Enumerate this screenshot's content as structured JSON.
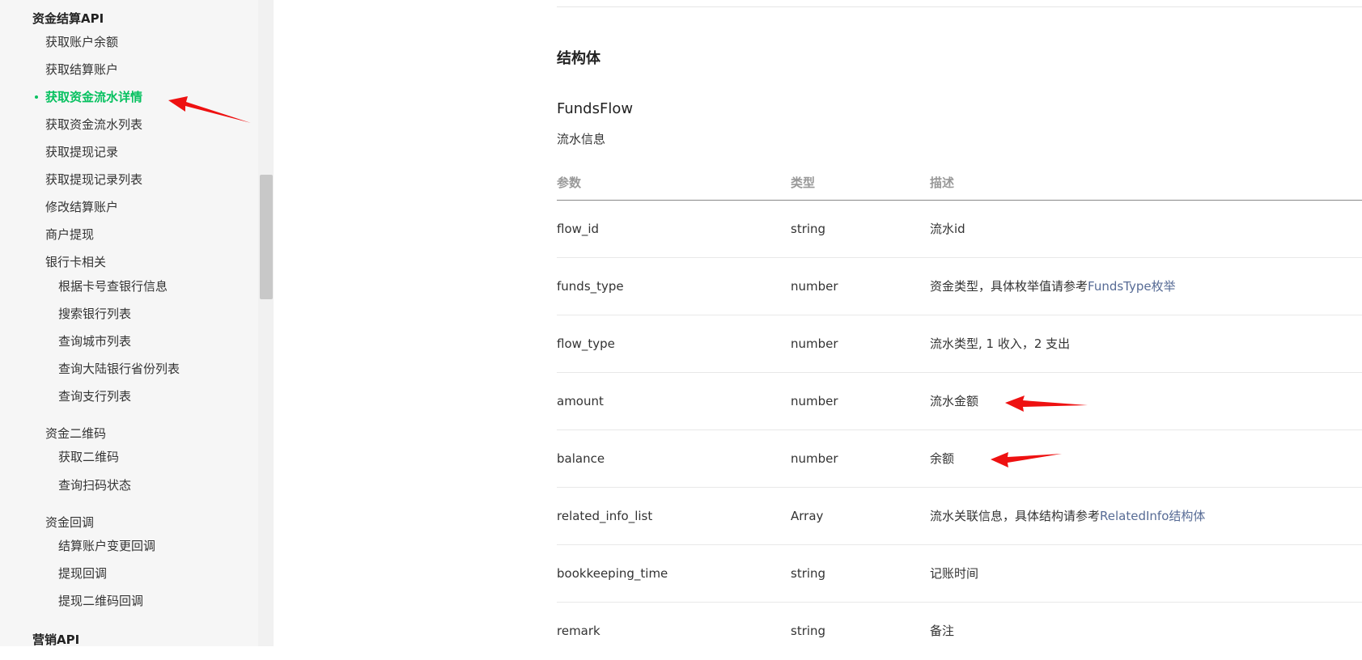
{
  "sidebar": {
    "groups": [
      {
        "label": "资金结算API"
      },
      {
        "label": "营销API"
      }
    ],
    "items": [
      {
        "label": "获取账户余额"
      },
      {
        "label": "获取结算账户"
      },
      {
        "label": "获取资金流水详情",
        "active": true
      },
      {
        "label": "获取资金流水列表"
      },
      {
        "label": "获取提现记录"
      },
      {
        "label": "获取提现记录列表"
      },
      {
        "label": "修改结算账户"
      },
      {
        "label": "商户提现"
      },
      {
        "label": "银行卡相关"
      },
      {
        "label": "根据卡号查银行信息"
      },
      {
        "label": "搜索银行列表"
      },
      {
        "label": "查询城市列表"
      },
      {
        "label": "查询大陆银行省份列表"
      },
      {
        "label": "查询支行列表"
      },
      {
        "label": "资金二维码"
      },
      {
        "label": "获取二维码"
      },
      {
        "label": "查询扫码状态"
      },
      {
        "label": "资金回调"
      },
      {
        "label": "结算账户变更回调"
      },
      {
        "label": "提现回调"
      },
      {
        "label": "提现二维码回调"
      }
    ]
  },
  "content": {
    "section_title": "结构体",
    "struct_name": "FundsFlow",
    "struct_desc": "流水信息",
    "headers": {
      "param": "参数",
      "type": "类型",
      "desc": "描述"
    },
    "rows": [
      {
        "param": "flow_id",
        "type": "string",
        "desc": "流水id"
      },
      {
        "param": "funds_type",
        "type": "number",
        "desc": "资金类型，具体枚举值请参考",
        "link": "FundsType枚举"
      },
      {
        "param": "flow_type",
        "type": "number",
        "desc": "流水类型, 1 收入，2 支出"
      },
      {
        "param": "amount",
        "type": "number",
        "desc": "流水金额"
      },
      {
        "param": "balance",
        "type": "number",
        "desc": "余额"
      },
      {
        "param": "related_info_list",
        "type": "Array",
        "desc": "流水关联信息，具体结构请参考",
        "link": "RelatedInfo结构体"
      },
      {
        "param": "bookkeeping_time",
        "type": "string",
        "desc": "记账时间"
      },
      {
        "param": "remark",
        "type": "string",
        "desc": "备注"
      }
    ]
  },
  "colors": {
    "active": "#07c160",
    "link": "#576b95",
    "annotation": "#ee1111"
  }
}
